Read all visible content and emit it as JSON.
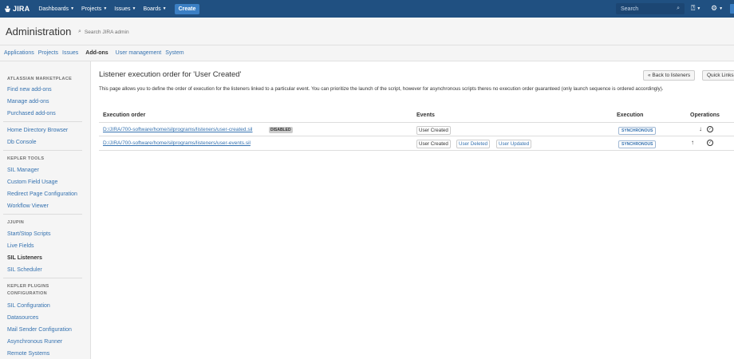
{
  "topnav": {
    "logo": "JIRA",
    "items": [
      "Dashboards",
      "Projects",
      "Issues",
      "Boards"
    ],
    "create": "Create",
    "search_placeholder": "Search"
  },
  "admin": {
    "title": "Administration",
    "search": "Search JIRA admin"
  },
  "subtabs": [
    "Applications",
    "Projects",
    "Issues",
    "Add-ons",
    "User management",
    "System"
  ],
  "sidebar": {
    "sec1_title": "ATLASSIAN MARKETPLACE",
    "sec1_items": [
      "Find new add-ons",
      "Manage add-ons",
      "Purchased add-ons"
    ],
    "sec2_items": [
      "Home Directory Browser",
      "Db Console"
    ],
    "sec3_title": "KEPLER TOOLS",
    "sec3_items": [
      "SIL Manager",
      "Custom Field Usage",
      "Redirect Page Configuration",
      "Workflow Viewer"
    ],
    "sec4_title": "JJUPIN",
    "sec4_items": [
      "Start/Stop Scripts",
      "Live Fields",
      "SIL Listeners",
      "SIL Scheduler"
    ],
    "sec5_title": "KEPLER PLUGINS CONFIGURATION",
    "sec5_items": [
      "SIL Configuration",
      "Datasources",
      "Mail Sender Configuration",
      "Asynchronous Runner",
      "Remote Systems"
    ]
  },
  "main": {
    "title": "Listener execution order for 'User Created'",
    "back_button": "« Back to listeners",
    "quick_button": "Quick Links",
    "description": "This page allows you to define the order of execution for the listeners linked to a particular event. You can prioritize the launch of the script, however for asynchronous scripts theres no execution order guaranteed (only launch sequence is ordered accordingly).",
    "columns": {
      "order": "Execution order",
      "events": "Events",
      "execution": "Execution",
      "operations": "Operations"
    },
    "rows": [
      {
        "path": "D:/JIRA/700-software/home/silprograms/listeners/user-created.sil",
        "status": "DISABLED",
        "events": [
          "User Created"
        ],
        "execution": "SYNCHRONOUS"
      },
      {
        "path": "D:/JIRA/700-software/home/silprograms/listeners/user-events.sil",
        "events": [
          "User Created",
          "User Deleted",
          "User Updated"
        ],
        "execution": "SYNCHRONOUS"
      }
    ]
  }
}
